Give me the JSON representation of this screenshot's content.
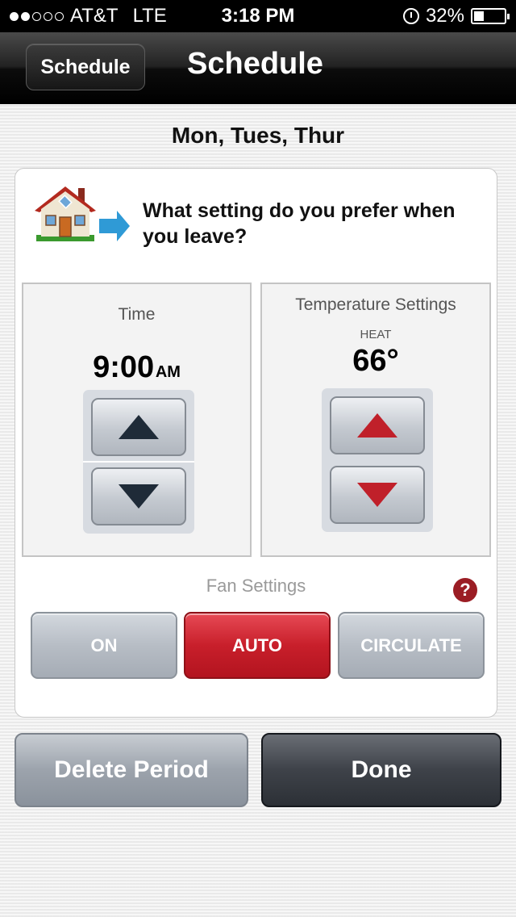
{
  "status_bar": {
    "signal_bars_filled": 2,
    "signal_bars_total": 5,
    "carrier": "AT&T",
    "network": "LTE",
    "time": "3:18 PM",
    "battery_text": "32%",
    "alarm_icon": "alarm-clock-icon"
  },
  "navbar": {
    "back_label": "Schedule",
    "title": "Schedule"
  },
  "days": "Mon, Tues, Thur",
  "prompt": {
    "icon": "house-leave-icon",
    "text": "What setting do you prefer when you leave?"
  },
  "time_panel": {
    "label": "Time",
    "value": "9:00",
    "ampm": "AM"
  },
  "temp_panel": {
    "label": "Temperature Settings",
    "mode": "HEAT",
    "value": "66°"
  },
  "fan": {
    "label": "Fan Settings",
    "help": "?",
    "options": [
      "ON",
      "AUTO",
      "CIRCULATE"
    ],
    "selected": "AUTO"
  },
  "actions": {
    "delete_label": "Delete Period",
    "done_label": "Done"
  },
  "colors": {
    "accent_red": "#c81f2b",
    "help_red": "#9b1d24",
    "arrow_dark": "#1f2b38"
  }
}
